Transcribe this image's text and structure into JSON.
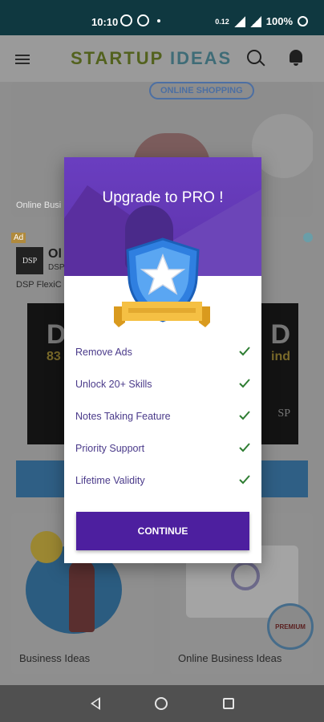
{
  "status_bar": {
    "time": "10:10",
    "data_speed": "0.12",
    "battery": "100%"
  },
  "app_bar": {
    "logo_part1": "STARTUP",
    "logo_part2": "IDEAS"
  },
  "banner": {
    "tag": "ONLINE SHOPPING",
    "label": "Online Busi"
  },
  "ad": {
    "badge": "Ad",
    "logo": "DSP",
    "title": "Ol",
    "subtitle": "DSP",
    "description": "DSP FlexiC ... ge, mid & small cap c",
    "image_text1": "D",
    "image_text2": "83",
    "image_text3": "D",
    "image_text4": "ind",
    "image_text5": "SP"
  },
  "tiles": [
    {
      "label": "Business Ideas"
    },
    {
      "label": "Online Business Ideas"
    }
  ],
  "premium_badge": "PREMIUM",
  "dialog": {
    "title": "Upgrade to PRO !",
    "features": [
      {
        "label": "Remove Ads"
      },
      {
        "label": "Unlock 20+ Skills"
      },
      {
        "label": "Notes Taking Feature"
      },
      {
        "label": "Priority Support"
      },
      {
        "label": "Lifetime Validity"
      }
    ],
    "continue_label": "CONTINUE",
    "accent_color": "#5b2fb0",
    "check_color": "#2e7d32"
  }
}
